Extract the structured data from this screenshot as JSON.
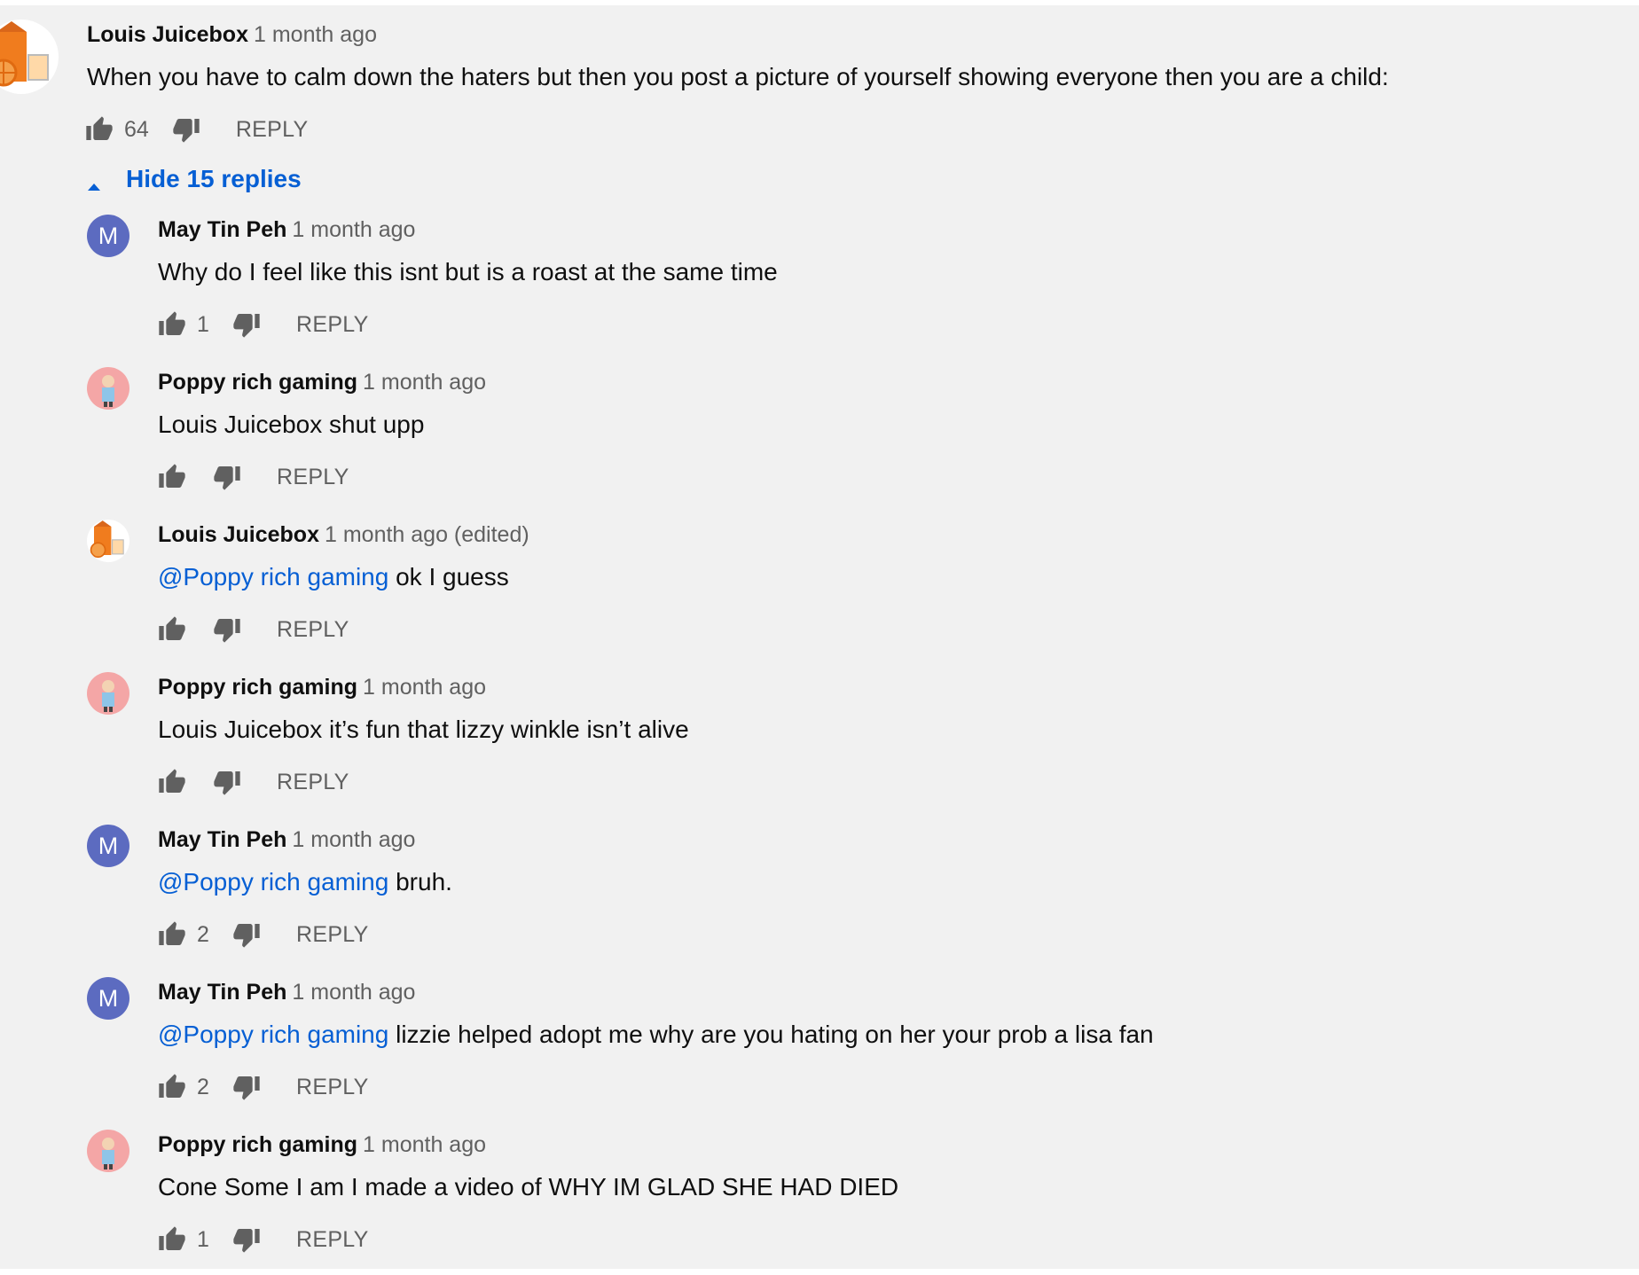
{
  "thread": {
    "top_comment": {
      "author": "Louis Juicebox",
      "time": "1 month ago",
      "text": "When you have to calm down the haters but then you post a picture of yourself showing everyone then you are a child:",
      "likes": "64",
      "reply_label": "REPLY",
      "avatar": "juicebox-avatar"
    },
    "toggle": {
      "label": "Hide 15 replies",
      "icon": "caret-up-icon",
      "color": "#065fd4"
    },
    "replies": [
      {
        "author": "May Tin Peh",
        "time": "1 month ago",
        "mention": "",
        "text": "Why do I feel like this isnt but is a roast at the same time",
        "likes": "1",
        "reply_label": "REPLY",
        "avatar": "M"
      },
      {
        "author": "Poppy rich gaming",
        "time": "1 month ago",
        "mention": "",
        "text": "Louis Juicebox shut upp",
        "likes": "",
        "reply_label": "REPLY",
        "avatar": "poppy-avatar"
      },
      {
        "author": "Louis Juicebox",
        "time": "1 month ago (edited)",
        "mention": "@Poppy rich gaming",
        "text": " ok I guess",
        "likes": "",
        "reply_label": "REPLY",
        "avatar": "juicebox-avatar"
      },
      {
        "author": "Poppy rich gaming",
        "time": "1 month ago",
        "mention": "",
        "text": "Louis Juicebox it’s fun that lizzy winkle isn’t alive",
        "likes": "",
        "reply_label": "REPLY",
        "avatar": "poppy-avatar"
      },
      {
        "author": "May Tin Peh",
        "time": "1 month ago",
        "mention": "@Poppy rich gaming",
        "text": " bruh.",
        "likes": "2",
        "reply_label": "REPLY",
        "avatar": "M"
      },
      {
        "author": "May Tin Peh",
        "time": "1 month ago",
        "mention": "@Poppy rich gaming",
        "text": " lizzie helped adopt me why are you hating on her your prob a lisa fan",
        "likes": "2",
        "reply_label": "REPLY",
        "avatar": "M"
      },
      {
        "author": "Poppy rich gaming",
        "time": "1 month ago",
        "mention": "",
        "text": "Cone Some I am I made a video of WHY IM GLAD SHE HAD DIED",
        "likes": "1",
        "reply_label": "REPLY",
        "avatar": "poppy-avatar"
      }
    ]
  },
  "colors": {
    "background": "#f1f1f1",
    "link": "#065fd4",
    "secondary_text": "#606060",
    "avatar_m": "#5c6bc0",
    "avatar_poppy": "#f4a6a6",
    "juicebox_orange": "#f07c1e"
  }
}
